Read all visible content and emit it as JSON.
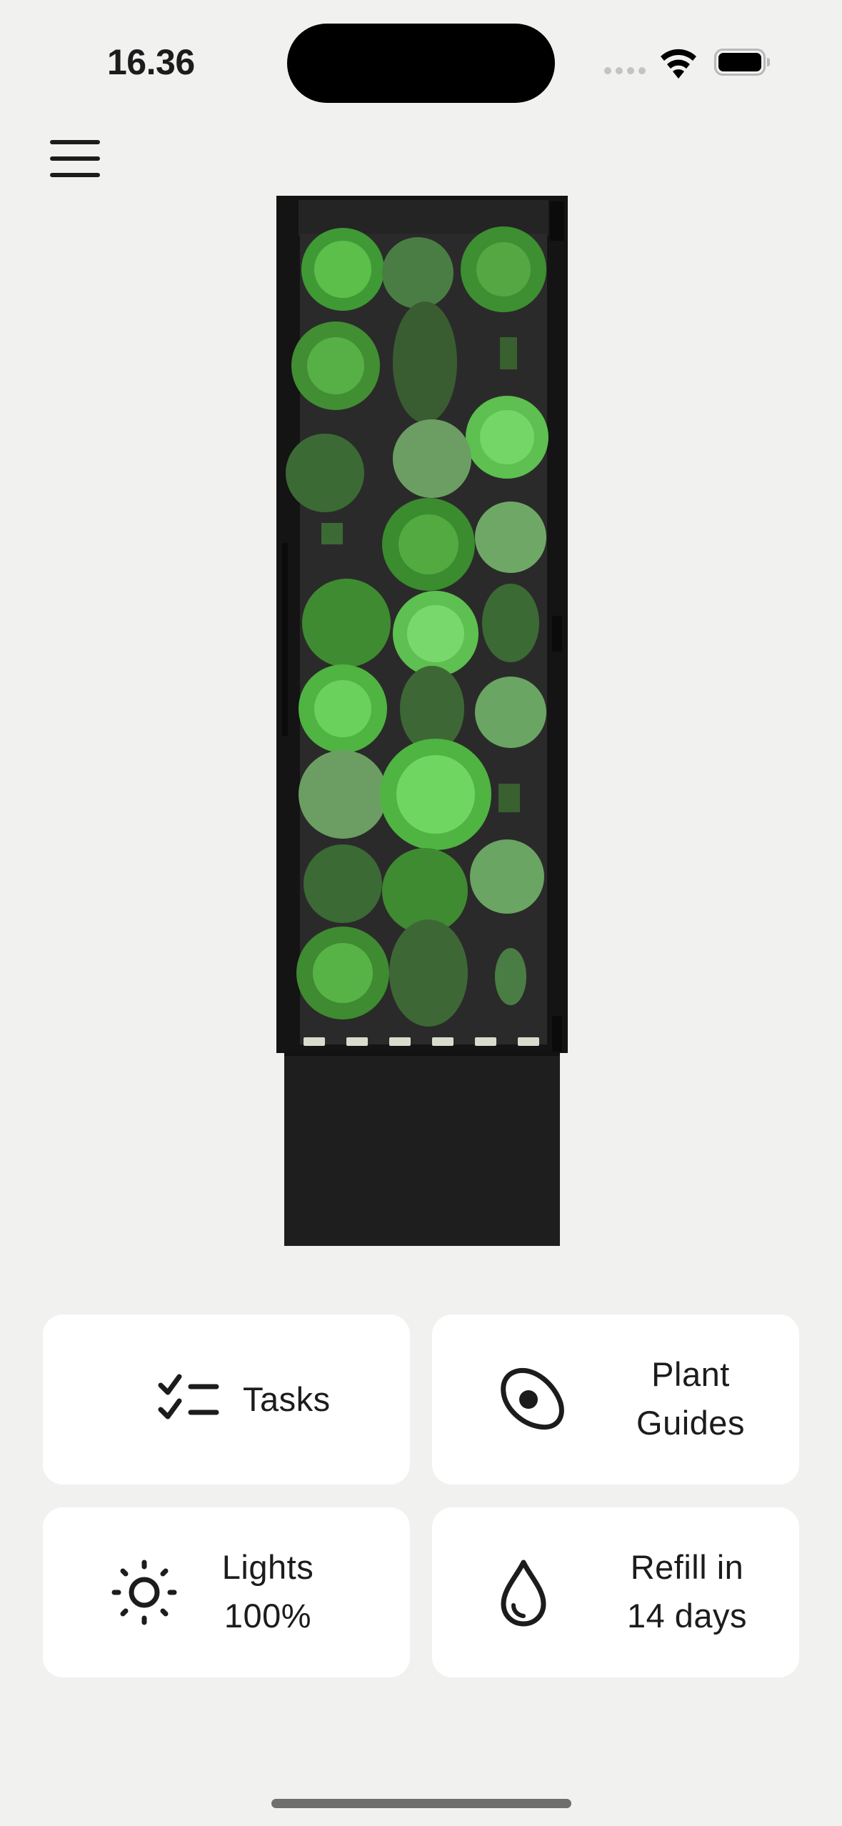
{
  "status_bar": {
    "time": "16.36"
  },
  "header": {
    "menu_icon": "hamburger-menu-icon"
  },
  "device": {
    "description_icon": "vertical-garden-tower"
  },
  "cards": {
    "tasks": {
      "label": "Tasks",
      "icon": "checklist-icon"
    },
    "plant_guides": {
      "label_line1": "Plant",
      "label_line2": "Guides",
      "icon": "seed-icon"
    },
    "lights": {
      "label_line1": "Lights",
      "label_line2": "100%",
      "icon": "sun-icon"
    },
    "refill": {
      "label_line1": "Refill in",
      "label_line2": "14 days",
      "icon": "water-drop-icon"
    }
  },
  "colors": {
    "background": "#f1f1f0",
    "card": "#ffffff",
    "text": "#1c1c1c",
    "tower_frame": "#1a1a1a"
  }
}
